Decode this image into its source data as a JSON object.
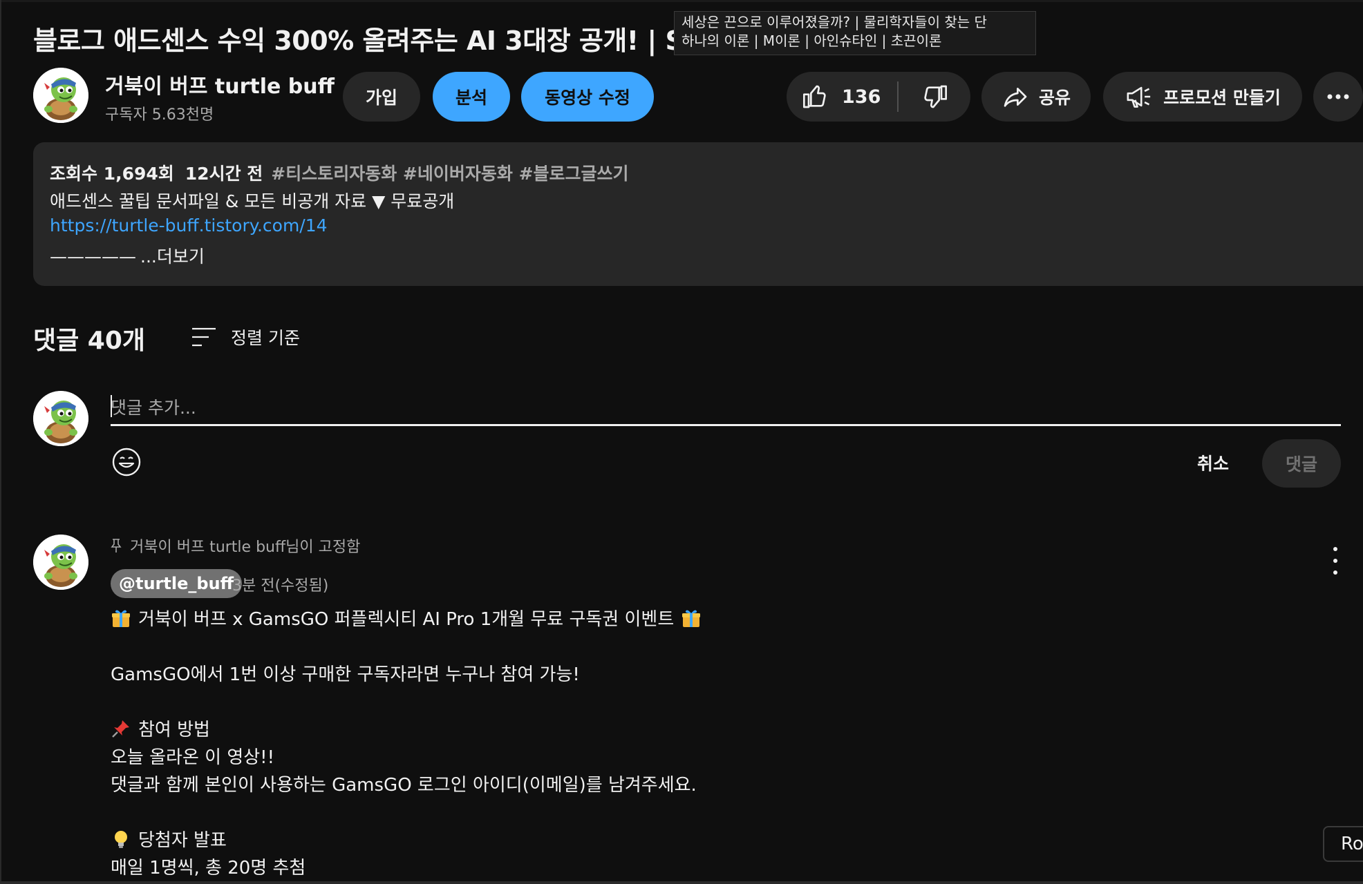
{
  "video": {
    "title": "블로그 애드센스 수익 300% 올려주는 AI 3대장 공개! | SEO"
  },
  "tooltip": {
    "line1": "세상은 끈으로 이루어졌을까? | 물리학자들이 찾는 단",
    "line2": "하나의 이론 | M이론 | 아인슈타인 | 초끈이론"
  },
  "channel": {
    "name": "거북이 버프 turtle buff",
    "subscribers": "구독자 5.63천명",
    "avatar_icon": "turtle-avatar-icon"
  },
  "actions": {
    "join": "가입",
    "analytics": "분석",
    "edit_video": "동영상 수정",
    "like_count": "136",
    "share": "공유",
    "promote": "프로모션 만들기"
  },
  "description": {
    "views": "조회수 1,694회",
    "time": "12시간 전",
    "tags": "#티스토리자동화 #네이버자동화 #블로그글쓰기",
    "line2": "애드센스 꿀팁 문서파일 & 모든 비공개 자료 ▼ 무료공개",
    "link": "https://turtle-buff.tistory.com/14",
    "dashes": "—————",
    "more": "...더보기"
  },
  "comments": {
    "count_label": "댓글 40개",
    "sort_label": "정렬 기준",
    "input_placeholder": "댓글 추가...",
    "cancel": "취소",
    "submit": "댓글"
  },
  "pinned_comment": {
    "pinned_by": "거북이 버프 turtle buff님이 고정함",
    "handle": "@turtle_buff",
    "time": "3분 전(수정됨)",
    "line1": "거북이 버프 x GamsGO 퍼플렉시티 AI Pro 1개월 무료 구독권 이벤트",
    "line2": "GamsGO에서 1번 이상 구매한 구독자라면 누구나 참여 가능!",
    "line3": "참여 방법",
    "line4": "오늘 올라온 이 영상!!",
    "line5": "댓글과 함께 본인이 사용하는 GamsGO 로그인 아이디(이메일)를 남겨주세요.",
    "line6": "당첨자 발표",
    "line7": "매일 1명씩, 총 20명 추첨"
  },
  "overlay": {
    "ro_label": "Ro"
  },
  "colors": {
    "background": "#0f0f0f",
    "surface": "#272727",
    "accent_blue": "#3ea6ff",
    "text_secondary": "#aaaaaa"
  }
}
